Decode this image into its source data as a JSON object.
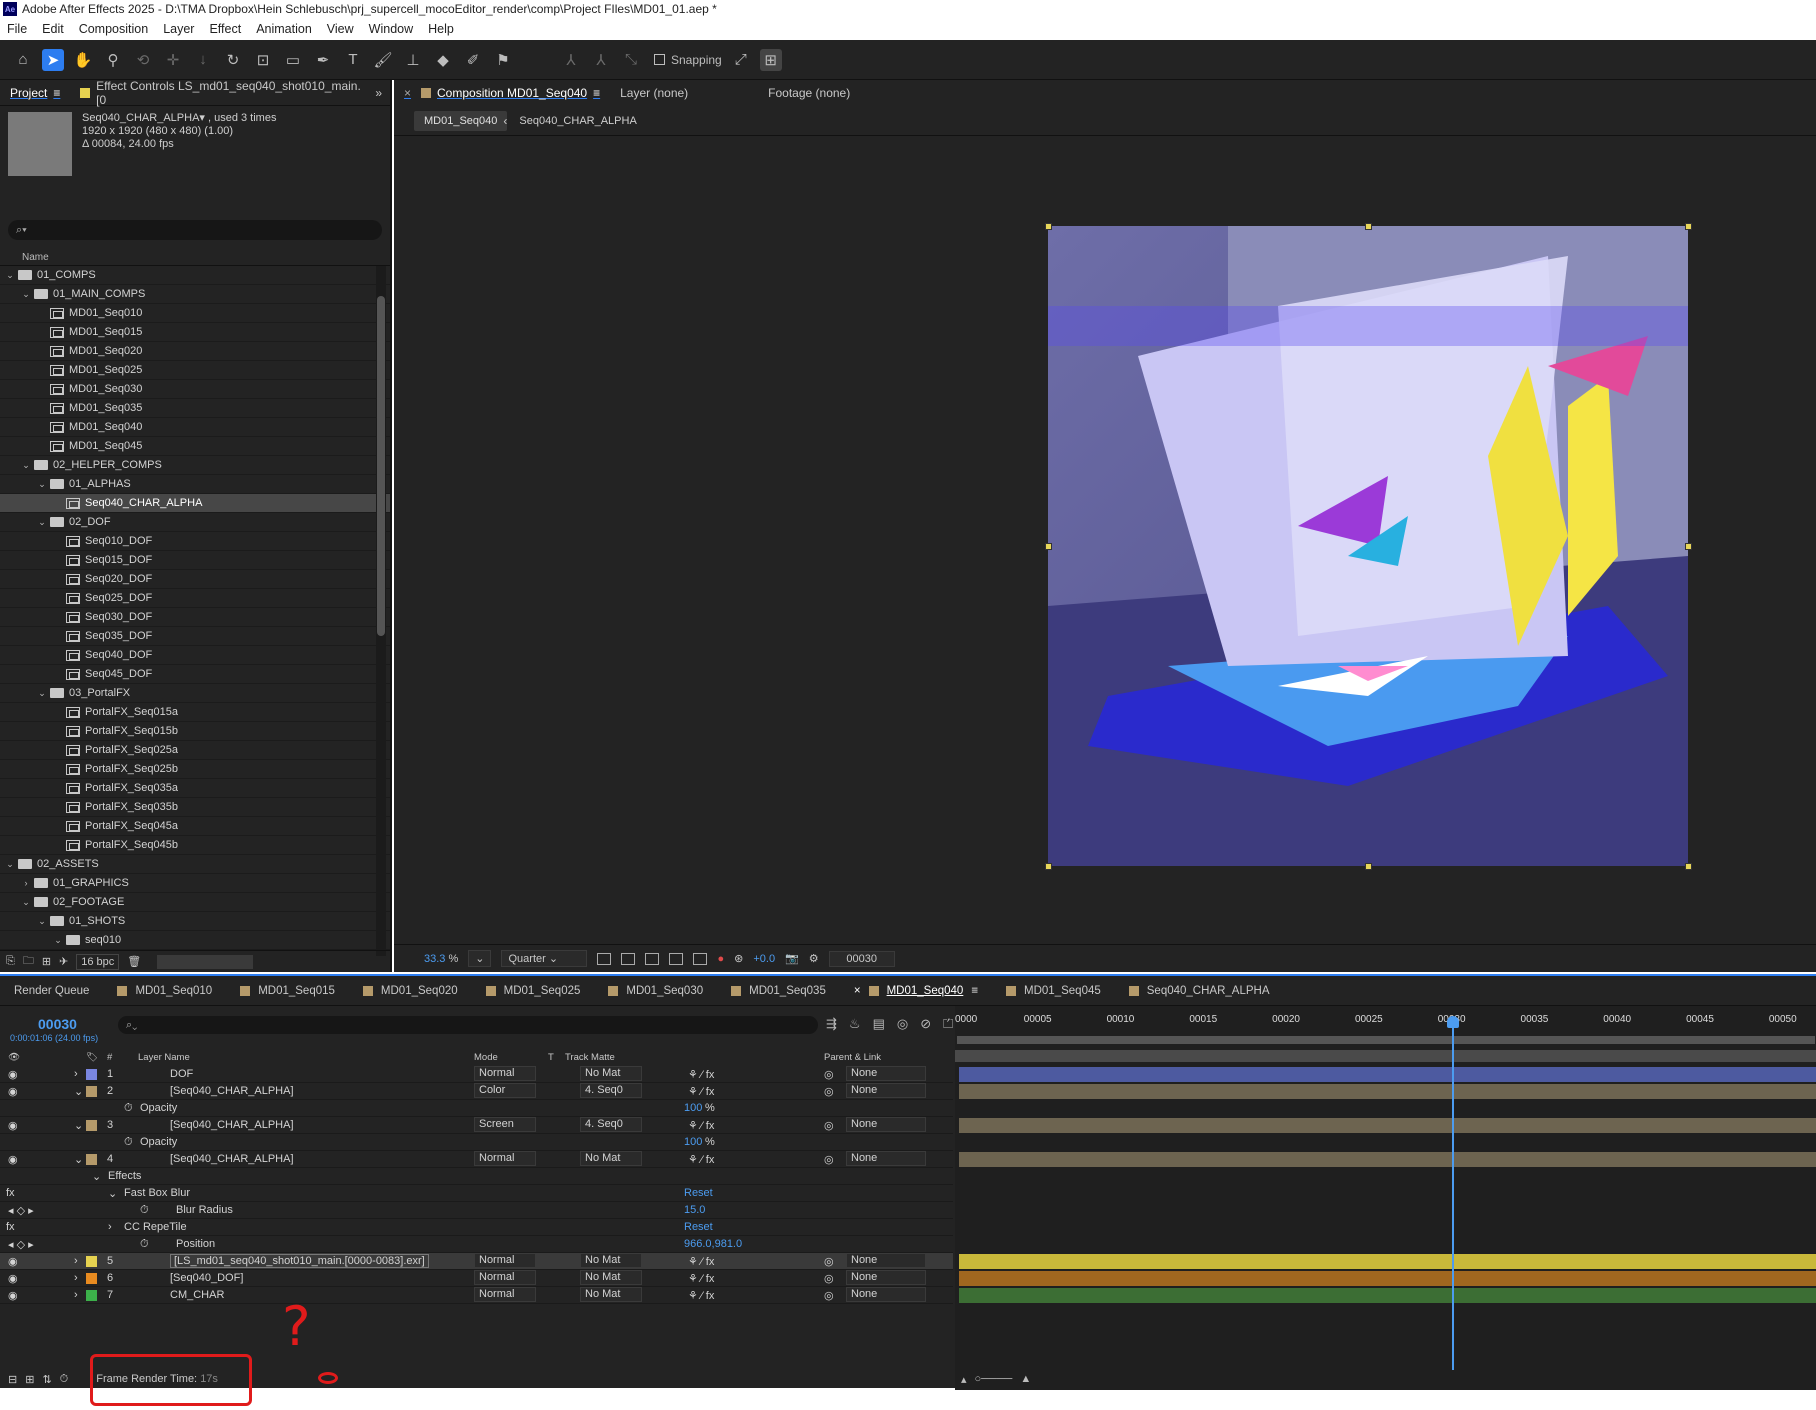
{
  "window": {
    "title": "Adobe After Effects 2025 - D:\\TMA Dropbox\\Hein Schlebusch\\prj_supercell_mocoEditor_render\\comp\\Project FIles\\MD01_01.aep *",
    "logo": "Ae"
  },
  "menu": [
    "File",
    "Edit",
    "Composition",
    "Layer",
    "Effect",
    "Animation",
    "View",
    "Window",
    "Help"
  ],
  "toolbar": {
    "snapping_label": "Snapping"
  },
  "project": {
    "tab_project": "Project",
    "tab_effect_controls": "Effect Controls LS_md01_seq040_shot010_main.[0",
    "info_name": "Seq040_CHAR_ALPHA▾ , used 3 times",
    "info_size": "1920 x 1920  (480 x 480) (1.00)",
    "info_duration": "Δ 00084, 24.00 fps",
    "search_placeholder": "⌕▾",
    "col_name": "Name",
    "tree": [
      {
        "label": "01_COMPS",
        "type": "folder",
        "depth": 0,
        "arrow": "⌄"
      },
      {
        "label": "01_MAIN_COMPS",
        "type": "folder",
        "depth": 1,
        "arrow": "⌄"
      },
      {
        "label": "MD01_Seq010",
        "type": "comp",
        "depth": 2
      },
      {
        "label": "MD01_Seq015",
        "type": "comp",
        "depth": 2
      },
      {
        "label": "MD01_Seq020",
        "type": "comp",
        "depth": 2
      },
      {
        "label": "MD01_Seq025",
        "type": "comp",
        "depth": 2
      },
      {
        "label": "MD01_Seq030",
        "type": "comp",
        "depth": 2
      },
      {
        "label": "MD01_Seq035",
        "type": "comp",
        "depth": 2
      },
      {
        "label": "MD01_Seq040",
        "type": "comp",
        "depth": 2
      },
      {
        "label": "MD01_Seq045",
        "type": "comp",
        "depth": 2
      },
      {
        "label": "02_HELPER_COMPS",
        "type": "folder",
        "depth": 1,
        "arrow": "⌄"
      },
      {
        "label": "01_ALPHAS",
        "type": "folder",
        "depth": 2,
        "arrow": "⌄"
      },
      {
        "label": "Seq040_CHAR_ALPHA",
        "type": "comp",
        "depth": 3,
        "selected": true
      },
      {
        "label": "02_DOF",
        "type": "folder",
        "depth": 2,
        "arrow": "⌄"
      },
      {
        "label": "Seq010_DOF",
        "type": "comp",
        "depth": 3
      },
      {
        "label": "Seq015_DOF",
        "type": "comp",
        "depth": 3
      },
      {
        "label": "Seq020_DOF",
        "type": "comp",
        "depth": 3
      },
      {
        "label": "Seq025_DOF",
        "type": "comp",
        "depth": 3
      },
      {
        "label": "Seq030_DOF",
        "type": "comp",
        "depth": 3
      },
      {
        "label": "Seq035_DOF",
        "type": "comp",
        "depth": 3
      },
      {
        "label": "Seq040_DOF",
        "type": "comp",
        "depth": 3
      },
      {
        "label": "Seq045_DOF",
        "type": "comp",
        "depth": 3
      },
      {
        "label": "03_PortalFX",
        "type": "folder",
        "depth": 2,
        "arrow": "⌄"
      },
      {
        "label": "PortalFX_Seq015a",
        "type": "comp",
        "depth": 3
      },
      {
        "label": "PortalFX_Seq015b",
        "type": "comp",
        "depth": 3
      },
      {
        "label": "PortalFX_Seq025a",
        "type": "comp",
        "depth": 3
      },
      {
        "label": "PortalFX_Seq025b",
        "type": "comp",
        "depth": 3
      },
      {
        "label": "PortalFX_Seq035a",
        "type": "comp",
        "depth": 3
      },
      {
        "label": "PortalFX_Seq035b",
        "type": "comp",
        "depth": 3
      },
      {
        "label": "PortalFX_Seq045a",
        "type": "comp",
        "depth": 3
      },
      {
        "label": "PortalFX_Seq045b",
        "type": "comp",
        "depth": 3
      },
      {
        "label": "02_ASSETS",
        "type": "folder",
        "depth": 0,
        "arrow": "⌄"
      },
      {
        "label": "01_GRAPHICS",
        "type": "folder",
        "depth": 1,
        "arrow": "›"
      },
      {
        "label": "02_FOOTAGE",
        "type": "folder",
        "depth": 1,
        "arrow": "⌄"
      },
      {
        "label": "01_SHOTS",
        "type": "folder",
        "depth": 2,
        "arrow": "⌄"
      },
      {
        "label": "seq010",
        "type": "folder",
        "depth": 3,
        "arrow": "⌄"
      }
    ],
    "bpc": "16 bpc"
  },
  "composition": {
    "tab_comp": "Composition MD01_Seq040",
    "tab_layer": "Layer (none)",
    "tab_footage": "Footage (none)",
    "crumb_active": "MD01_Seq040",
    "crumb_next": "Seq040_CHAR_ALPHA",
    "zoom": "33.3",
    "zoom_unit": "%",
    "resolution": "Quarter",
    "exposure": "+0.0",
    "timecode": "00030"
  },
  "timeline": {
    "tabs": [
      "Render Queue",
      "MD01_Seq010",
      "MD01_Seq015",
      "MD01_Seq020",
      "MD01_Seq025",
      "MD01_Seq030",
      "MD01_Seq035",
      "MD01_Seq040",
      "MD01_Seq045",
      "Seq040_CHAR_ALPHA"
    ],
    "active_tab": "MD01_Seq040",
    "timecode": "00030",
    "timecode_sub": "0:00:01:06 (24.00 fps)",
    "headers": {
      "num": "#",
      "layer_name": "Layer Name",
      "mode": "Mode",
      "t": "T",
      "track_matte": "Track Matte",
      "parent": "Parent & Link"
    },
    "ruler_ticks": [
      "0000",
      "00005",
      "00010",
      "00015",
      "00020",
      "00025",
      "00030",
      "00035",
      "00040",
      "00045",
      "00050"
    ],
    "playhead_frame": 30,
    "visible_frames": 52,
    "rows": [
      {
        "kind": "layer",
        "num": "1",
        "name": "DOF",
        "color": "#7a86e0",
        "mode": "Normal",
        "matte": "No Mat",
        "parent": "None",
        "bar": "#4d5aa0"
      },
      {
        "kind": "layer",
        "num": "2",
        "name": "[Seq040_CHAR_ALPHA]",
        "color": "#b59a6a",
        "mode": "Color",
        "matte": "4. Seq0",
        "parent": "None",
        "bar": "#6d6450"
      },
      {
        "kind": "prop",
        "name": "Opacity",
        "value": "100",
        "unit": "%"
      },
      {
        "kind": "layer",
        "num": "3",
        "name": "[Seq040_CHAR_ALPHA]",
        "color": "#b59a6a",
        "mode": "Screen",
        "matte": "4. Seq0",
        "parent": "None",
        "bar": "#6d6450"
      },
      {
        "kind": "prop",
        "name": "Opacity",
        "value": "100",
        "unit": "%"
      },
      {
        "kind": "layer",
        "num": "4",
        "name": "[Seq040_CHAR_ALPHA]",
        "color": "#b59a6a",
        "mode": "Normal",
        "matte": "No Mat",
        "parent": "None",
        "bar": "#6d6450"
      },
      {
        "kind": "group",
        "name": "Effects"
      },
      {
        "kind": "effect",
        "name": "Fast Box Blur",
        "value": "Reset"
      },
      {
        "kind": "prop2",
        "name": "Blur Radius",
        "value": "15.0"
      },
      {
        "kind": "effect",
        "name": "CC RepeTile",
        "value": "Reset"
      },
      {
        "kind": "prop2",
        "name": "Position",
        "value": "966.0,981.0"
      },
      {
        "kind": "layer",
        "num": "5",
        "name": "[LS_md01_seq040_shot010_main.[0000-0083].exr]",
        "color": "#e6d250",
        "mode": "Normal",
        "matte": "No Mat",
        "parent": "None",
        "bar": "#c9b83a",
        "selected": true,
        "boxed": true
      },
      {
        "kind": "layer",
        "num": "6",
        "name": "[Seq040_DOF]",
        "color": "#e88b20",
        "mode": "Normal",
        "matte": "No Mat",
        "parent": "None",
        "bar": "#a0671f"
      },
      {
        "kind": "layer",
        "num": "7",
        "name": "CM_CHAR",
        "color": "#3cb04a",
        "mode": "Normal",
        "matte": "No Mat",
        "parent": "None",
        "bar": "#3c6e34"
      }
    ],
    "frame_render_label": "Frame Render Time:",
    "frame_render_value": "17s"
  },
  "annotation": {
    "mark": "?",
    "color": "#e01b1b"
  }
}
